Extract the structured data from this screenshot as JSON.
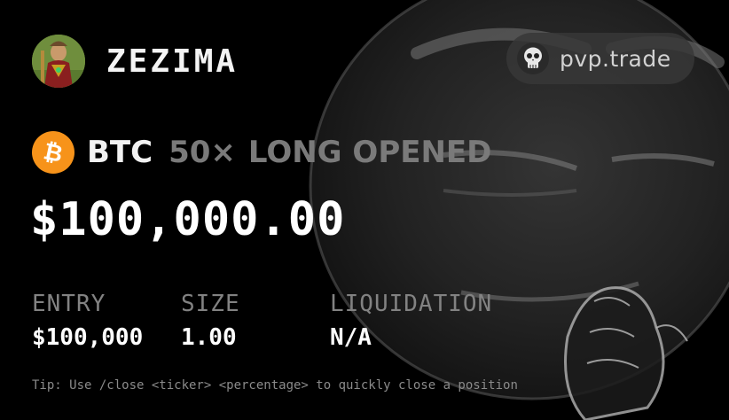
{
  "header": {
    "username": "ZEZIMA",
    "avatar_icon": "runescape-character-avatar"
  },
  "brand": {
    "label": "pvp.trade",
    "icon": "skull-icon"
  },
  "position": {
    "coin_icon": "bitcoin-icon",
    "coin_color": "#f7931a",
    "ticker": "BTC",
    "leverage": "50×",
    "status": "LONG OPENED",
    "price": "$100,000.00"
  },
  "stats": {
    "entry_label": "ENTRY",
    "entry_value": "$100,000",
    "size_label": "SIZE",
    "size_value": "1.00",
    "liquidation_label": "LIQUIDATION",
    "liquidation_value": "N/A"
  },
  "tip": "Tip: Use /close <ticker> <percentage> to quickly close a position",
  "colors": {
    "background": "#000000",
    "muted_text": "#7a7a7a",
    "brand_pill": "#373737"
  }
}
